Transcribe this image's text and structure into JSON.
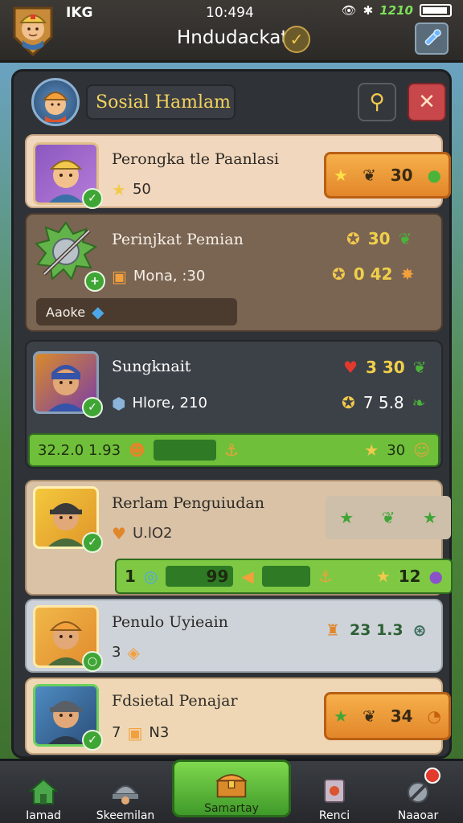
{
  "status_bar": {
    "carrier": "IKG",
    "time": "10:494",
    "signal_text": "1210"
  },
  "header": {
    "title": "Hndudackat"
  },
  "panel": {
    "title": "Sosial Hamlam"
  },
  "rows": [
    {
      "name": "Perongka tle Paanlasi",
      "sub_value": "50",
      "pill_value": "30"
    },
    {
      "name": "Perinjkat Pemian",
      "sub_value": "Mona, :30",
      "stat_a_value": "30",
      "stat_b_value": "0 42",
      "tag_label": "Aaoke"
    },
    {
      "name": "Sungknait",
      "sub_value": "Hlore, 210",
      "stat_a_value": "3 30",
      "stat_b_value": "7 5.8",
      "bar_left_value": "32.2.0 1.93",
      "bar_right_value": "30"
    },
    {
      "name": "Rerlam Penguiudan",
      "sub_value": "U.lO2",
      "bar_left_value": "1",
      "bar_mid_value": "99",
      "bar_right_value": "12"
    },
    {
      "name": "Penulo Uyieain",
      "sub_value": "3",
      "stat_value": "23 1.3"
    },
    {
      "name": "Fdsietal Penajar",
      "sub_value": "7",
      "sub_extra": "N3",
      "pill_value": "34"
    }
  ],
  "bottom_nav": [
    {
      "label": "Iamad"
    },
    {
      "label": "Skeemilan"
    },
    {
      "label": "Samartay"
    },
    {
      "label": "Renci"
    },
    {
      "label": "Naaoar"
    }
  ],
  "colors": {
    "accent_orange": "#e2862a",
    "accent_green": "#3f9a2a",
    "title_gold": "#f4d35e",
    "close_red": "#c7474a"
  }
}
